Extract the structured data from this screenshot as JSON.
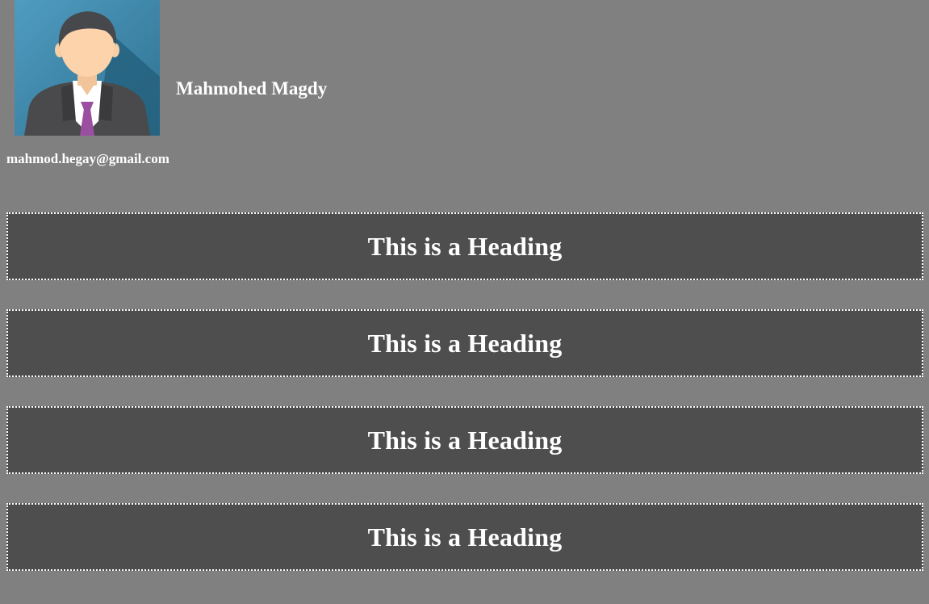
{
  "profile": {
    "name": "Mahmohed Magdy",
    "email": "mahmod.hegay@gmail.com",
    "avatar_icon": "businessman-avatar-icon"
  },
  "sections": [
    {
      "heading": "This is a Heading"
    },
    {
      "heading": "This is a Heading"
    },
    {
      "heading": "This is a Heading"
    },
    {
      "heading": "This is a Heading"
    }
  ],
  "colors": {
    "page_background": "#808080",
    "section_background": "#4e4e4e",
    "text": "#ffffff",
    "avatar_background": "#4a90b2",
    "tie": "#9b4fa0"
  }
}
